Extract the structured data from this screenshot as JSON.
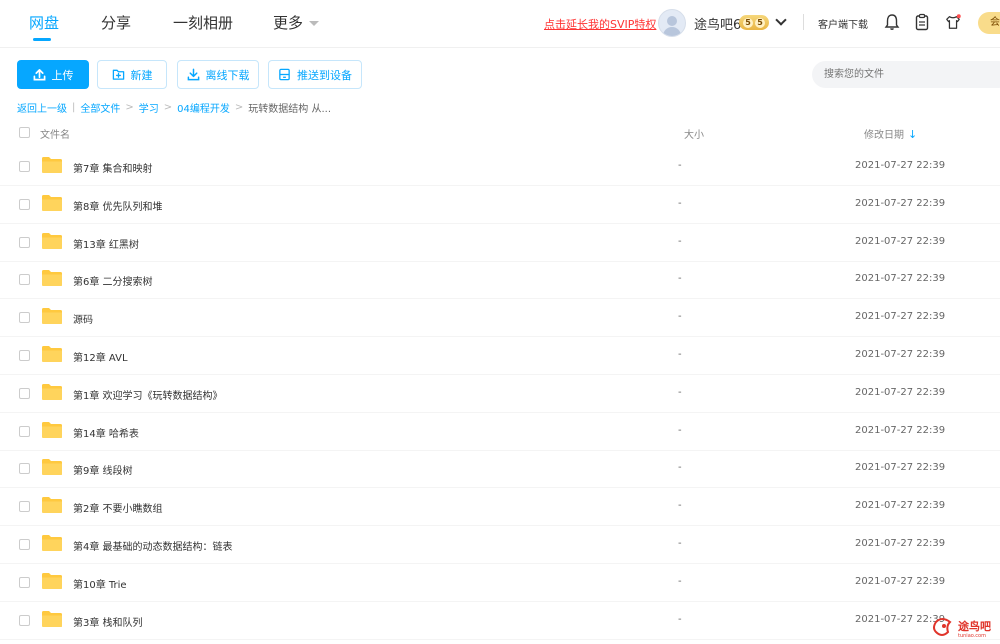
{
  "nav": {
    "items": [
      {
        "label": "网盘",
        "active": true
      },
      {
        "label": "分享",
        "active": false
      },
      {
        "label": "一刻相册",
        "active": false
      },
      {
        "label": "更多",
        "active": false
      }
    ]
  },
  "header": {
    "svip_link": "点击延长我的SVIP特权",
    "username": "途鸟吧6",
    "level_badge": [
      "5",
      "5"
    ],
    "client_download": "客户端下载",
    "vip_pill": "会"
  },
  "toolbar": {
    "upload": "上传",
    "new_folder": "新建",
    "offline_download": "离线下载",
    "push_to_device": "推送到设备",
    "search_placeholder": "搜索您的文件"
  },
  "breadcrumb": {
    "back": "返回上一级",
    "items": [
      "全部文件",
      "学习",
      "04编程开发"
    ],
    "current": "玩转数据结构 从..."
  },
  "table": {
    "col_name": "文件名",
    "col_size": "大小",
    "col_date": "修改日期",
    "rows": [
      {
        "name": "第7章 集合和映射",
        "size": "-",
        "date": "2021-07-27 22:39"
      },
      {
        "name": "第8章 优先队列和堆",
        "size": "-",
        "date": "2021-07-27 22:39"
      },
      {
        "name": "第13章 红黑树",
        "size": "-",
        "date": "2021-07-27 22:39"
      },
      {
        "name": "第6章 二分搜索树",
        "size": "-",
        "date": "2021-07-27 22:39"
      },
      {
        "name": "源码",
        "size": "-",
        "date": "2021-07-27 22:39"
      },
      {
        "name": "第12章 AVL",
        "size": "-",
        "date": "2021-07-27 22:39"
      },
      {
        "name": "第1章 欢迎学习《玩转数据结构》",
        "size": "-",
        "date": "2021-07-27 22:39"
      },
      {
        "name": "第14章 哈希表",
        "size": "-",
        "date": "2021-07-27 22:39"
      },
      {
        "name": "第9章 线段树",
        "size": "-",
        "date": "2021-07-27 22:39"
      },
      {
        "name": "第2章 不要小瞧数组",
        "size": "-",
        "date": "2021-07-27 22:39"
      },
      {
        "name": "第4章 最基础的动态数据结构：链表",
        "size": "-",
        "date": "2021-07-27 22:39"
      },
      {
        "name": "第10章 Trie",
        "size": "-",
        "date": "2021-07-27 22:39"
      },
      {
        "name": "第3章 栈和队列",
        "size": "-",
        "date": "2021-07-27 22:39"
      }
    ]
  },
  "watermark": {
    "text": "途鸟吧",
    "sub": "tuniao.com"
  },
  "colors": {
    "accent": "#06a7ff",
    "svip": "#ff3333",
    "folder": "#ffc93f"
  }
}
